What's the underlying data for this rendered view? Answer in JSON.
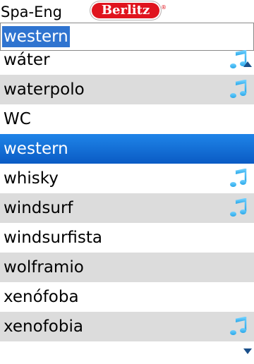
{
  "header": {
    "language_pair": "Spa-Eng",
    "brand": "Berlitz",
    "brand_mark": "®"
  },
  "search": {
    "value": "western"
  },
  "list": {
    "items": [
      {
        "label": "wáter",
        "audio": true,
        "scroll_up": true
      },
      {
        "label": "waterpolo",
        "audio": true
      },
      {
        "label": "WC",
        "audio": false
      },
      {
        "label": "western",
        "audio": false,
        "selected": true
      },
      {
        "label": "whisky",
        "audio": true
      },
      {
        "label": "windsurf",
        "audio": true
      },
      {
        "label": "windsurfista",
        "audio": false
      },
      {
        "label": "wolframio",
        "audio": false
      },
      {
        "label": "xenófoba",
        "audio": false
      },
      {
        "label": "xenofobia",
        "audio": true,
        "scroll_down": true
      }
    ]
  },
  "colors": {
    "selection": "#1677e0",
    "alt_row": "#dcdcdc",
    "search_highlight": "#2f74d0",
    "brand": "#e0141e",
    "audio_icon": "#2aa7e8"
  }
}
